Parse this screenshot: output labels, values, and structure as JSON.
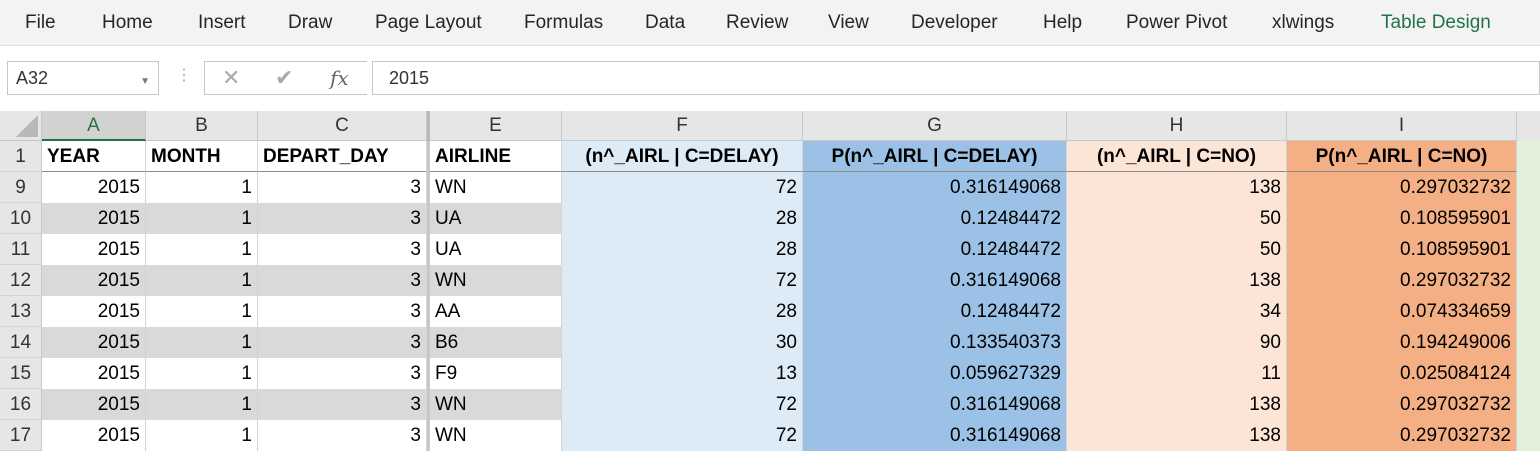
{
  "ribbon": {
    "tabs": [
      "File",
      "Home",
      "Insert",
      "Draw",
      "Page Layout",
      "Formulas",
      "Data",
      "Review",
      "View",
      "Developer",
      "Help",
      "Power Pivot",
      "xlwings",
      "Table Design"
    ],
    "active_tab": "Table Design",
    "active_color": "#217346"
  },
  "formula_bar": {
    "name_box": "A32",
    "cancel_icon": "✕",
    "enter_icon": "✔",
    "function_icon": "fx",
    "content": "2015"
  },
  "sheet": {
    "columns": [
      "A",
      "B",
      "C",
      "E",
      "F",
      "G",
      "H",
      "I"
    ],
    "selected_column": "A",
    "header_row_number": "1",
    "headers": [
      "YEAR",
      "MONTH",
      "DEPART_DAY",
      "AIRLINE",
      "(n^_AIRL | C=DELAY)",
      "P(n^_AIRL | C=DELAY)",
      "(n^_AIRL | C=NO)",
      "P(n^_AIRL | C=NO)"
    ],
    "rows": [
      {
        "row": "9",
        "cells": [
          "2015",
          "1",
          "3",
          "WN",
          "72",
          "0.316149068",
          "138",
          "0.297032732"
        ]
      },
      {
        "row": "10",
        "cells": [
          "2015",
          "1",
          "3",
          "UA",
          "28",
          "0.12484472",
          "50",
          "0.108595901"
        ]
      },
      {
        "row": "11",
        "cells": [
          "2015",
          "1",
          "3",
          "UA",
          "28",
          "0.12484472",
          "50",
          "0.108595901"
        ]
      },
      {
        "row": "12",
        "cells": [
          "2015",
          "1",
          "3",
          "WN",
          "72",
          "0.316149068",
          "138",
          "0.297032732"
        ]
      },
      {
        "row": "13",
        "cells": [
          "2015",
          "1",
          "3",
          "AA",
          "28",
          "0.12484472",
          "34",
          "0.074334659"
        ]
      },
      {
        "row": "14",
        "cells": [
          "2015",
          "1",
          "3",
          "B6",
          "30",
          "0.133540373",
          "90",
          "0.194249006"
        ]
      },
      {
        "row": "15",
        "cells": [
          "2015",
          "1",
          "3",
          "F9",
          "13",
          "0.059627329",
          "11",
          "0.025084124"
        ]
      },
      {
        "row": "16",
        "cells": [
          "2015",
          "1",
          "3",
          "WN",
          "72",
          "0.316149068",
          "138",
          "0.297032732"
        ]
      },
      {
        "row": "17",
        "cells": [
          "2015",
          "1",
          "3",
          "WN",
          "72",
          "0.316149068",
          "138",
          "0.297032732"
        ]
      }
    ],
    "colors": {
      "band_light": "#ffffff",
      "band_dark": "#d9d9d9",
      "col_f": "#ddebf7",
      "col_g": "#9bc2e6",
      "col_h": "#fce4d6",
      "col_i": "#f4b084",
      "col_next": "#e2efda"
    }
  }
}
